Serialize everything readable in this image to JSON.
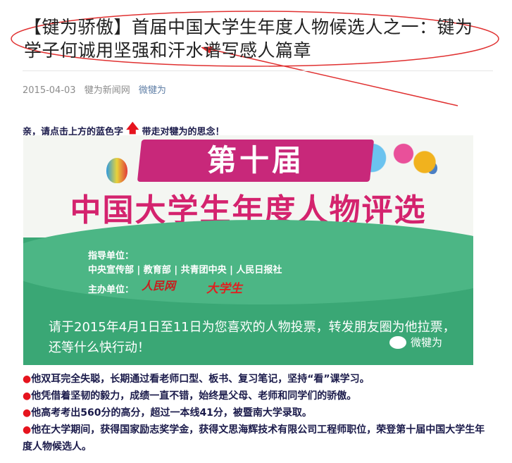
{
  "article": {
    "title": "【键为骄傲】首届中国大学生年度人物候选人之一：键为学子何诚用坚强和汗水谱写感人篇章",
    "date": "2015-04-03",
    "source": "犍为新闻网",
    "account": "微犍为",
    "prompt_before": "亲，请点击上方的蓝色字",
    "prompt_after": "带走对犍为的思念！"
  },
  "banner": {
    "ribbon": "第十届",
    "headline": "中国大学生年度人物评选",
    "guide_label": "指导单位：",
    "guide_units": "中央宣传部 | 教育部 | 共青团中央 | 人民日报社",
    "host_label": "主办单位：",
    "host_logo1": "人民网",
    "host_logo2": "大学生",
    "vote_text": "请于2015年4月1日至11日为您喜欢的人物投票，转发朋友圈为他拉票，还等什么快行动！",
    "watermark": "微犍为"
  },
  "bullets": [
    "他双耳完全失聪，长期通过看老师口型、板书、复习笔记，坚持“看”课学习。",
    "他凭借着坚韧的毅力，成绩一直不错，始终是父母、老师和同学们的骄傲。",
    "他高考考出560分的高分，超过一本线41分，被暨南大学录取。",
    "他在大学期间，获得国家励志奖学金，获得文思海辉技术有限公司工程师职位，荣登第十届中国大学生年度人物候选人。"
  ],
  "colors": {
    "annotation": "#e03030",
    "accent_red": "#e6141e",
    "banner_pink": "#d4236e",
    "banner_green": "#3aa775",
    "link": "#607fa6"
  },
  "icons": {
    "prompt_arrow": "up-arrow-icon",
    "bullet": "red-dot-icon",
    "watermark": "wechat-icon"
  }
}
